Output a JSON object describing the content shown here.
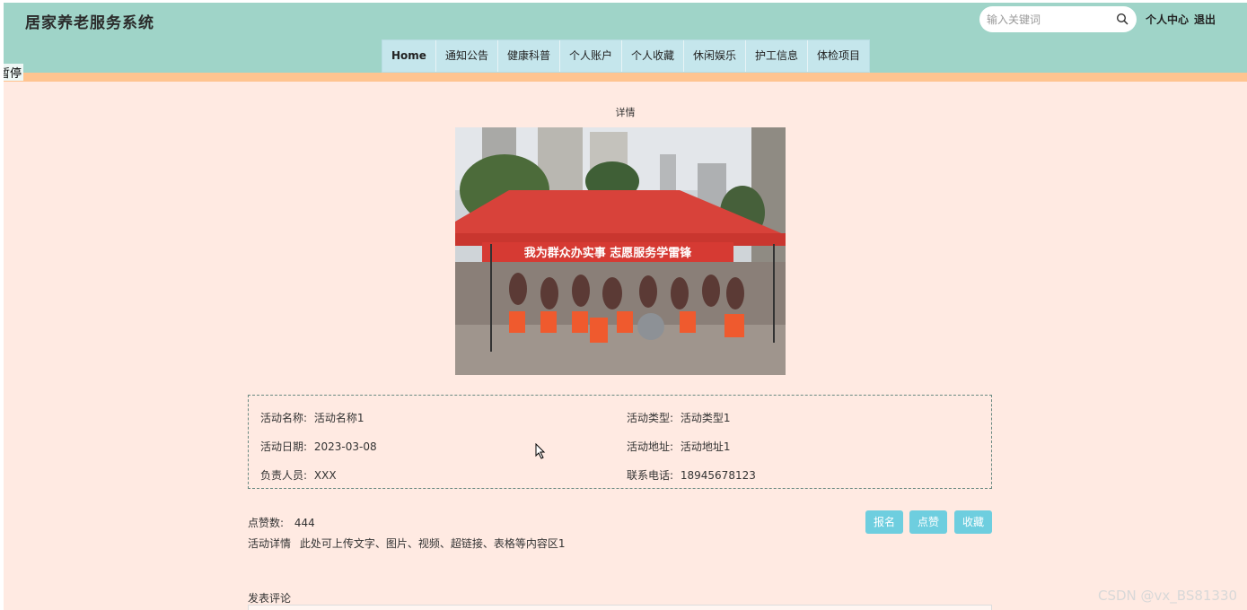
{
  "app": {
    "title": "居家养老服务系统"
  },
  "header": {
    "search_placeholder": "输入关键词",
    "user_center": "个人中心",
    "logout": "退出"
  },
  "nav": {
    "items": [
      {
        "label": "Home"
      },
      {
        "label": "通知公告"
      },
      {
        "label": "健康科普"
      },
      {
        "label": "个人账户"
      },
      {
        "label": "个人收藏"
      },
      {
        "label": "休闲娱乐"
      },
      {
        "label": "护工信息"
      },
      {
        "label": "体检项目"
      }
    ]
  },
  "side_tag": "暂停",
  "page": {
    "section_title": "详情",
    "photo_banner_text": "我为群众办实事  志愿服务学雷锋"
  },
  "info": {
    "name": {
      "label": "活动名称:",
      "value": "活动名称1"
    },
    "type": {
      "label": "活动类型:",
      "value": "活动类型1"
    },
    "date": {
      "label": "活动日期:",
      "value": "2023-03-08"
    },
    "address": {
      "label": "活动地址:",
      "value": "活动地址1"
    },
    "person": {
      "label": "负责人员:",
      "value": "XXX"
    },
    "phone": {
      "label": "联系电话:",
      "value": "18945678123"
    }
  },
  "stats": {
    "likes_label": "点赞数:",
    "likes_value": "444",
    "detail_label": "活动详情",
    "detail_value": "此处可上传文字、图片、视频、超链接、表格等内容区1"
  },
  "actions": {
    "signup": "报名",
    "like": "点赞",
    "favorite": "收藏"
  },
  "comment": {
    "label": "发表评论"
  },
  "watermark": "CSDN @vx_BS81330",
  "colors": {
    "header_bg": "#9fd4c8",
    "accent_stripe": "#ffc490",
    "page_bg": "#ffeae2",
    "button_bg": "#6ecedf"
  }
}
